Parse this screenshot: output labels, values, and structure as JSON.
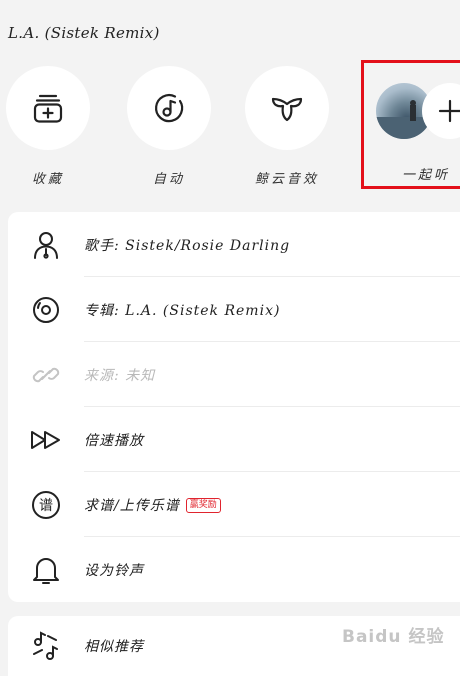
{
  "song": {
    "title": "L.A. (Sistek Remix)"
  },
  "quick_actions": [
    {
      "label": "收藏",
      "icon": "add-to-collection-icon"
    },
    {
      "label": "自动",
      "icon": "auto-music-icon"
    },
    {
      "label": "鲸云音效",
      "icon": "whale-cloud-sound-effect-icon"
    }
  ],
  "listen_together": {
    "label": "一起听",
    "icon": "plus-icon"
  },
  "menu": [
    {
      "label": "歌手: Sistek/Rosie Darling",
      "icon": "artist-icon"
    },
    {
      "label": "专辑: L.A. (Sistek Remix)",
      "icon": "album-icon"
    },
    {
      "label": "来源: 未知",
      "icon": "link-icon",
      "disabled": true
    },
    {
      "label": "倍速播放",
      "icon": "fast-forward-icon"
    },
    {
      "label": "求谱/上传乐谱",
      "icon": "sheet-music-icon",
      "badge": "赢奖励"
    },
    {
      "label": "设为铃声",
      "icon": "bell-icon"
    },
    {
      "label": "相似推荐",
      "icon": "similar-music-icon"
    }
  ],
  "watermark": {
    "text": "Baidu 经验"
  },
  "colors": {
    "highlight_border": "#e3101a",
    "badge": "#e0242e"
  }
}
